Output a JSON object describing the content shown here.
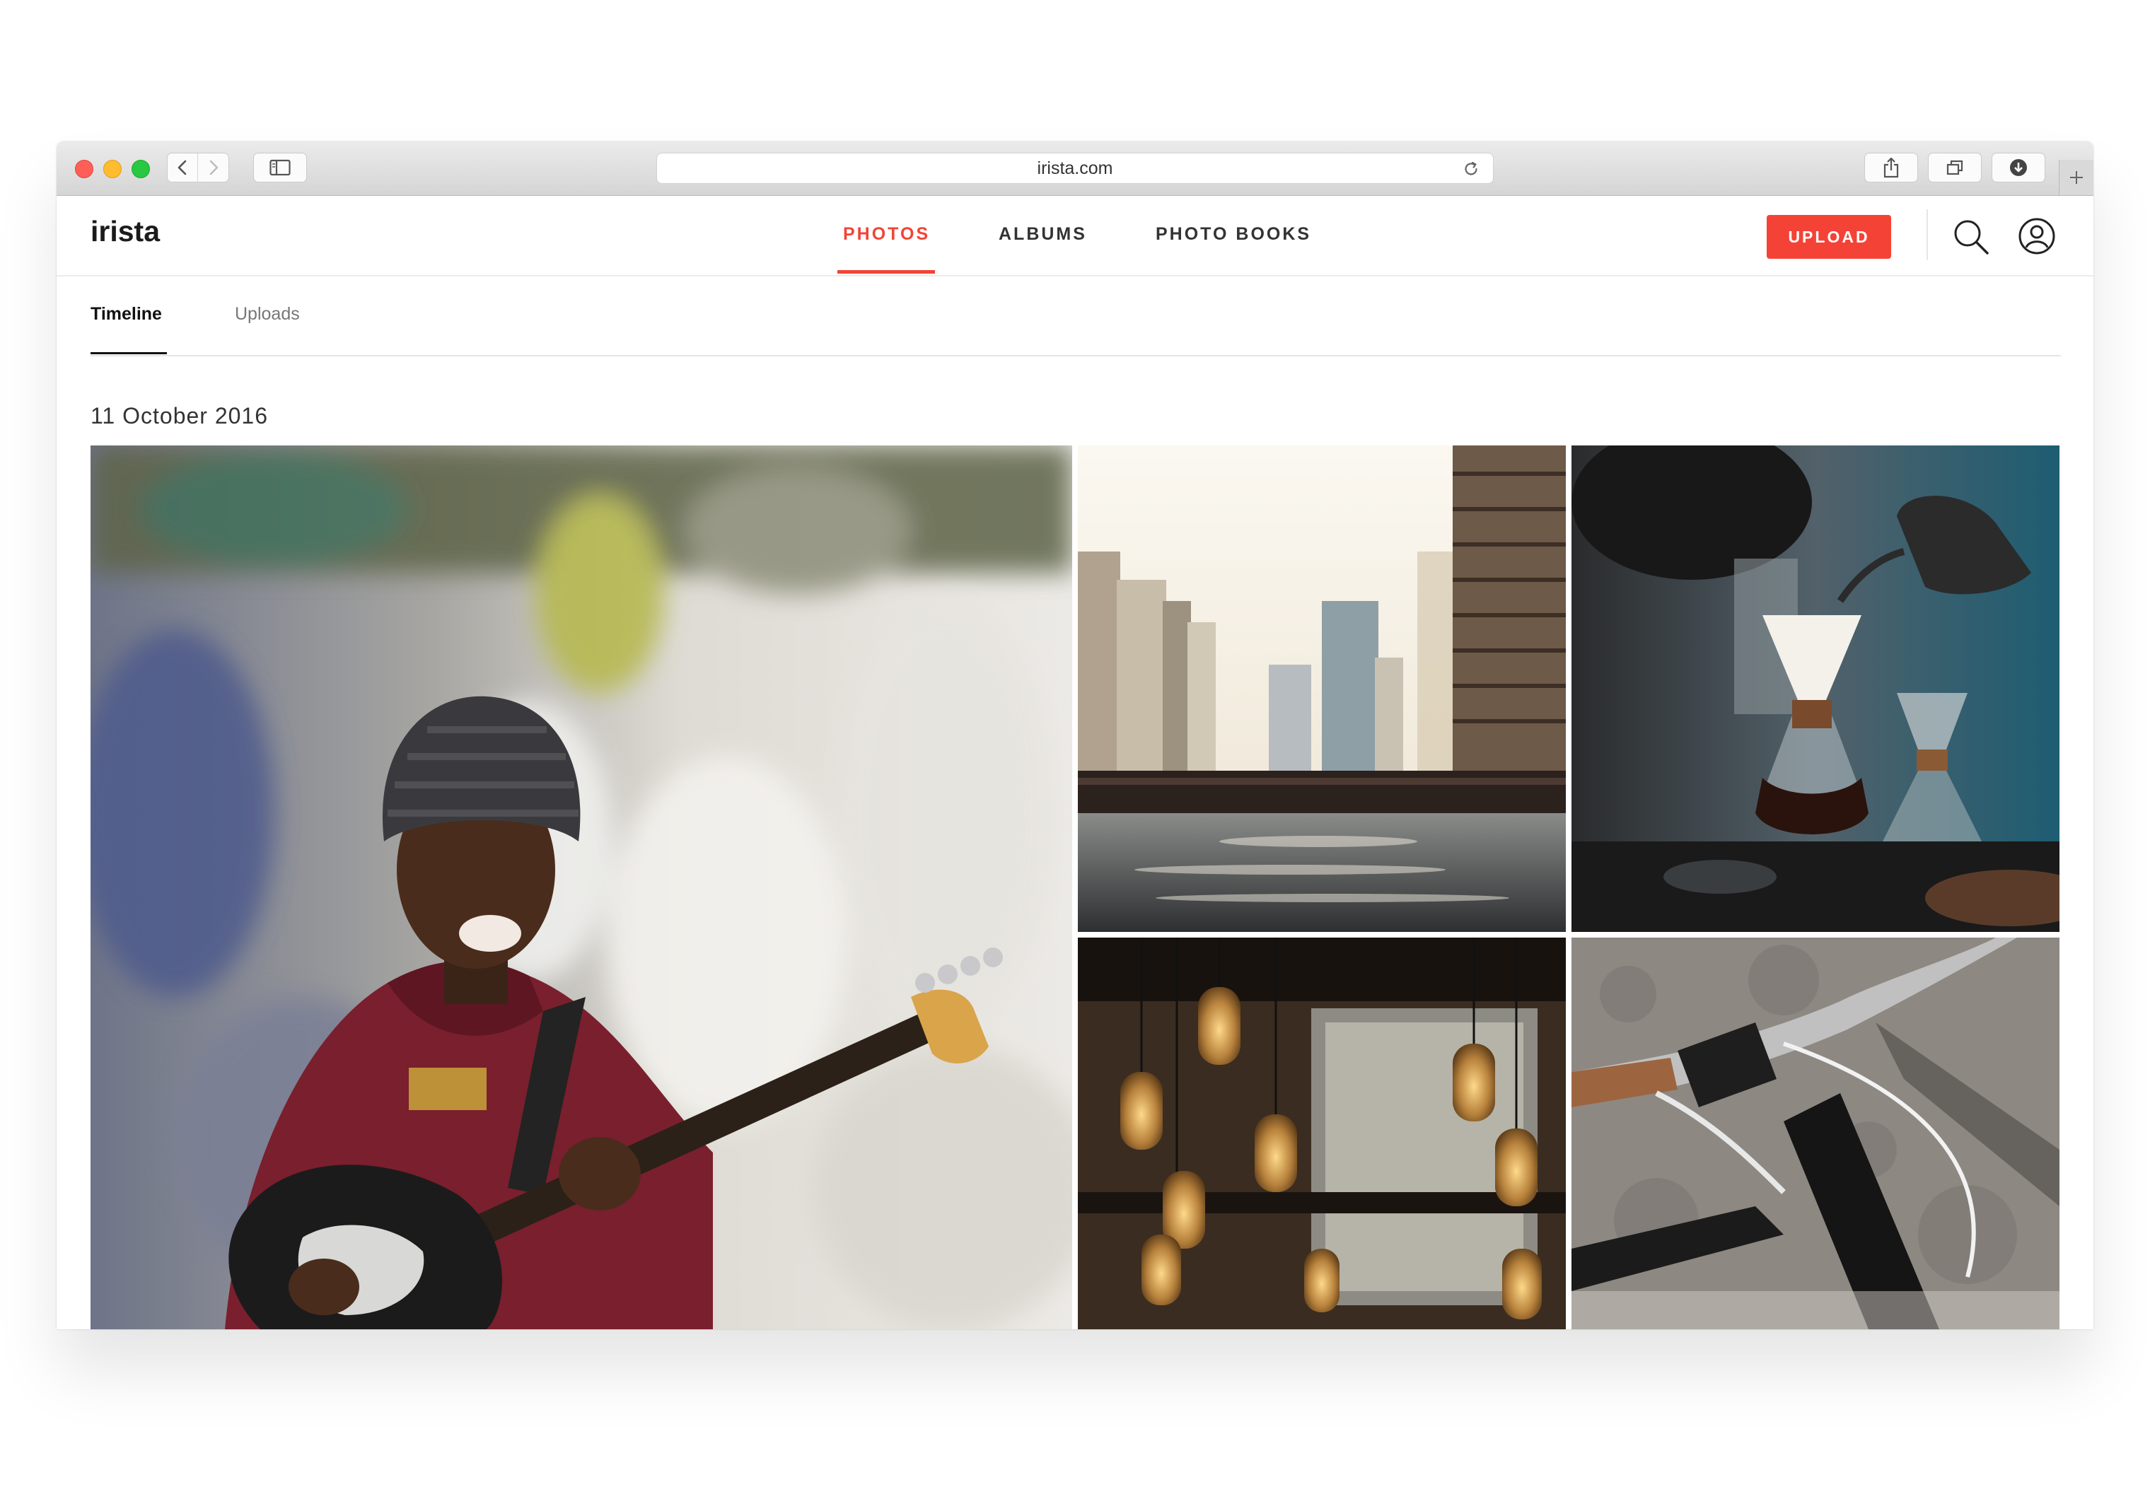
{
  "browser": {
    "url": "irista.com",
    "traffic_lights": {
      "close": "#ff5f57",
      "minimize": "#febc2e",
      "zoom": "#28c840"
    },
    "icons": {
      "back": "chevron-left-icon",
      "forward": "chevron-right-icon",
      "sidebar": "sidebar-icon",
      "reload": "reload-icon",
      "share": "share-icon",
      "tabs": "tabs-overview-icon",
      "downloads": "download-icon",
      "new_tab": "plus-icon"
    }
  },
  "app": {
    "logo": "irista",
    "accent_color": "#f44336",
    "nav": [
      {
        "label": "PHOTOS",
        "active": true
      },
      {
        "label": "ALBUMS",
        "active": false
      },
      {
        "label": "PHOTO BOOKS",
        "active": false
      }
    ],
    "upload_label": "UPLOAD",
    "icons": {
      "search": "search-icon",
      "account": "user-account-icon"
    }
  },
  "subtabs": [
    {
      "label": "Timeline",
      "active": true
    },
    {
      "label": "Uploads",
      "active": false
    }
  ],
  "timeline": {
    "date": "11 October 2016",
    "photos": [
      {
        "subject": "musician-playing-bass-guitar-by-graffiti-wall"
      },
      {
        "subject": "city-river-skyline"
      },
      {
        "subject": "pour-over-coffee-brewing"
      },
      {
        "subject": "hanging-edison-bulb-lamps"
      },
      {
        "subject": "bicycle-handlebar"
      }
    ]
  }
}
